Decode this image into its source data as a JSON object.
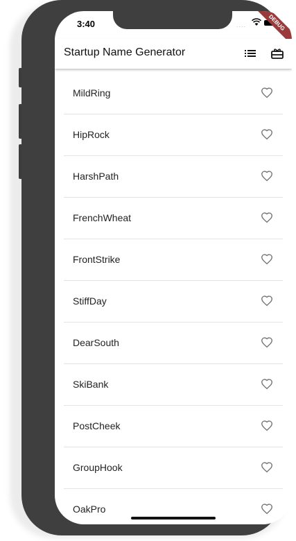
{
  "status_bar": {
    "time": "3:40",
    "signal": "....",
    "debug_label": "DEBUG"
  },
  "app_bar": {
    "title": "Startup Name Generator",
    "actions": [
      {
        "icon": "list-icon"
      },
      {
        "icon": "gift-card-icon"
      }
    ]
  },
  "list": {
    "items": [
      {
        "label": "MildRing",
        "favorited": false
      },
      {
        "label": "HipRock",
        "favorited": false
      },
      {
        "label": "HarshPath",
        "favorited": false
      },
      {
        "label": "FrenchWheat",
        "favorited": false
      },
      {
        "label": "FrontStrike",
        "favorited": false
      },
      {
        "label": "StiffDay",
        "favorited": false
      },
      {
        "label": "DearSouth",
        "favorited": false
      },
      {
        "label": "SkiBank",
        "favorited": false
      },
      {
        "label": "PostCheek",
        "favorited": false
      },
      {
        "label": "GroupHook",
        "favorited": false
      },
      {
        "label": "OakPro",
        "favorited": false
      }
    ]
  },
  "colors": {
    "frame": "#3f3f3f",
    "ribbon": "#9b3a3a",
    "heart_outline": "#757575",
    "divider": "#e4e4e4"
  }
}
